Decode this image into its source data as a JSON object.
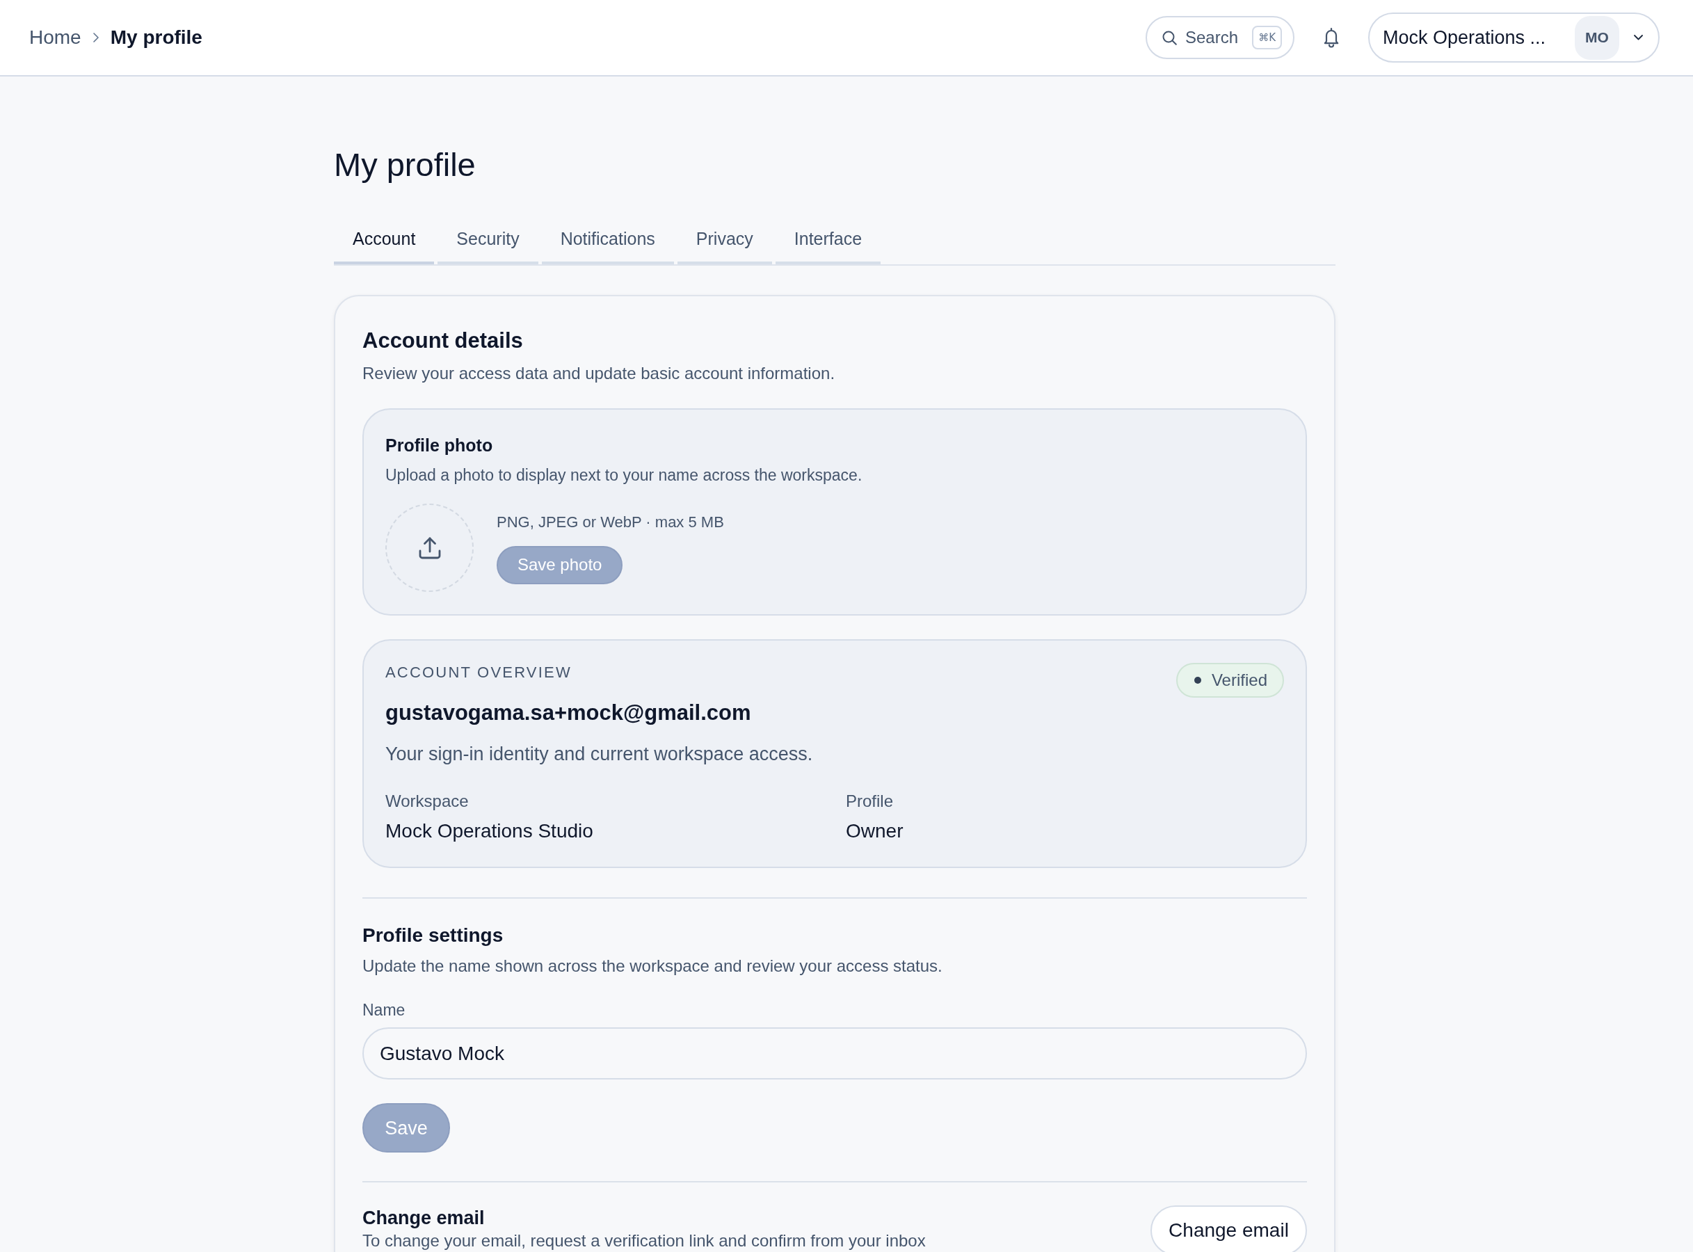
{
  "header": {
    "breadcrumb": [
      {
        "label": "Home",
        "current": false
      },
      {
        "label": "My profile",
        "current": true
      }
    ],
    "search": {
      "label": "Search",
      "shortcut": "⌘K"
    },
    "account_menu": {
      "name": "Mock Operations ...",
      "initials": "MO"
    }
  },
  "page": {
    "title": "My profile"
  },
  "tabs": [
    {
      "label": "Account",
      "selected": true
    },
    {
      "label": "Security",
      "selected": false
    },
    {
      "label": "Notifications",
      "selected": false
    },
    {
      "label": "Privacy",
      "selected": false
    },
    {
      "label": "Interface",
      "selected": false
    }
  ],
  "account_details": {
    "title": "Account details",
    "subtitle": "Review your access data and update basic account information.",
    "profile_photo": {
      "title": "Profile photo",
      "subtitle": "Upload a photo to display next to your name across the workspace.",
      "hint": "PNG, JPEG or WebP · max 5 MB",
      "button": {
        "label": "Save photo",
        "disabled": true
      }
    },
    "account_overview": {
      "eyebrow": "ACCOUNT OVERVIEW",
      "badge": {
        "label": "Verified"
      },
      "email": "gustavogama.sa+mock@gmail.com",
      "description": "Your sign-in identity and current workspace access.",
      "fields": [
        {
          "label": "Workspace",
          "value": "Mock Operations Studio"
        },
        {
          "label": "Profile",
          "value": "Owner"
        }
      ]
    },
    "profile_settings": {
      "title": "Profile settings",
      "subtitle": "Update the name shown across the workspace and review your access status.",
      "name_field": {
        "label": "Name",
        "value": "Gustavo Mock"
      },
      "button": {
        "label": "Save",
        "disabled": true
      }
    },
    "change_email": {
      "title": "Change email",
      "subtitle": "To change your email, request a verification link and confirm from your inbox",
      "button": {
        "label": "Change email"
      }
    }
  }
}
